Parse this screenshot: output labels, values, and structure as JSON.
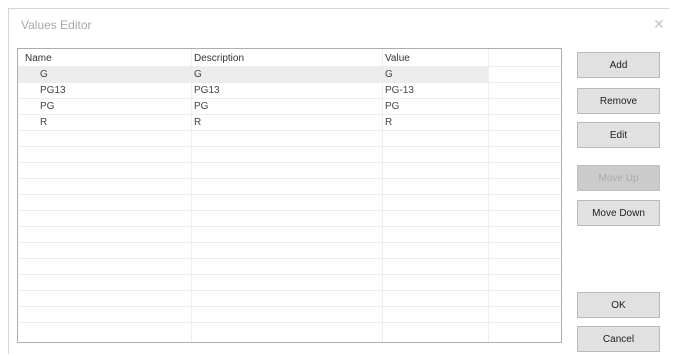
{
  "window": {
    "title": "Values Editor",
    "close_glyph": "✕"
  },
  "table": {
    "columns": [
      "Name",
      "Description",
      "Value"
    ],
    "rows": [
      {
        "name": "G",
        "description": "G",
        "value": "G"
      },
      {
        "name": "PG13",
        "description": "PG13",
        "value": "PG-13"
      },
      {
        "name": "PG",
        "description": "PG",
        "value": "PG"
      },
      {
        "name": "R",
        "description": "R",
        "value": "R"
      }
    ],
    "selected_row": 0
  },
  "buttons": {
    "add": "Add",
    "remove": "Remove",
    "edit": "Edit",
    "move_up": "Move Up",
    "move_down": "Move Down",
    "ok": "OK",
    "cancel": "Cancel"
  },
  "states": {
    "move_up_disabled": true
  }
}
